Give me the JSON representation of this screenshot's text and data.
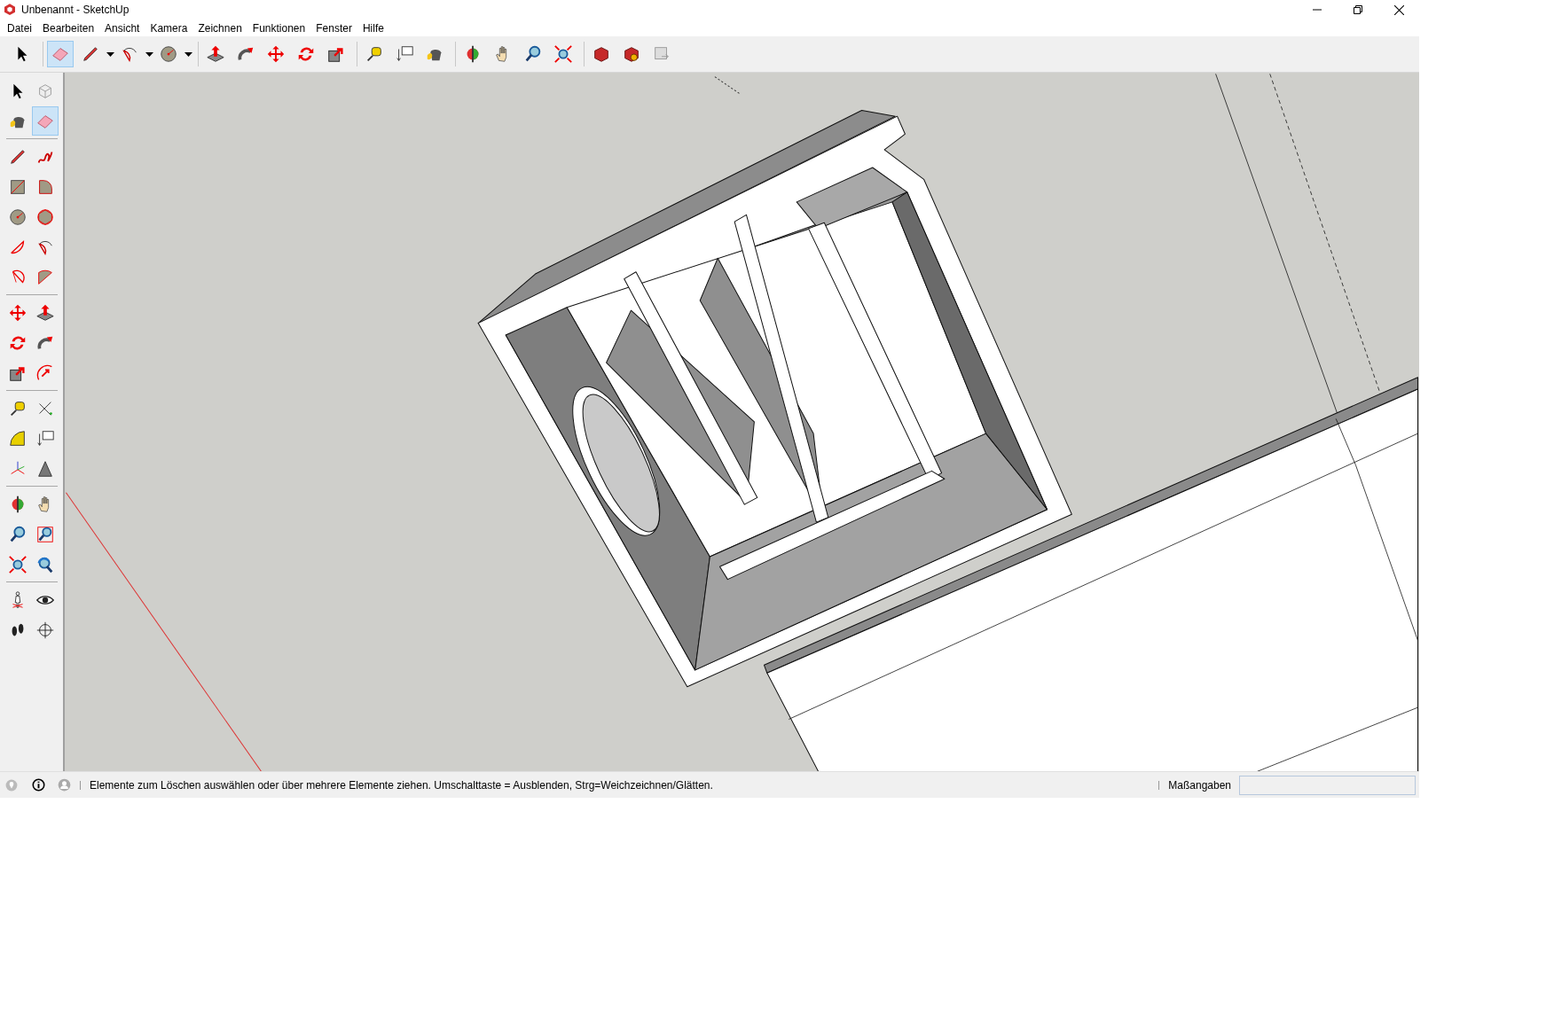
{
  "window": {
    "title": "Unbenannt - SketchUp"
  },
  "menu": [
    "Datei",
    "Bearbeiten",
    "Ansicht",
    "Kamera",
    "Zeichnen",
    "Funktionen",
    "Fenster",
    "Hilfe"
  ],
  "top_toolbar": {
    "groups": [
      [
        {
          "kind": "select",
          "selected": false
        }
      ],
      [
        {
          "kind": "eraser",
          "selected": true
        },
        {
          "kind": "pencil",
          "selected": false,
          "dropdown": true
        },
        {
          "kind": "arc2",
          "selected": false,
          "dropdown": true
        },
        {
          "kind": "circle",
          "selected": false,
          "dropdown": true
        }
      ],
      [
        {
          "kind": "pushpull",
          "selected": false
        },
        {
          "kind": "followme",
          "selected": false
        },
        {
          "kind": "move",
          "selected": false
        },
        {
          "kind": "rotate",
          "selected": false
        },
        {
          "kind": "scale",
          "selected": false
        }
      ],
      [
        {
          "kind": "tape",
          "selected": false
        },
        {
          "kind": "text",
          "selected": false
        },
        {
          "kind": "paint",
          "selected": false
        }
      ],
      [
        {
          "kind": "orbit",
          "selected": false
        },
        {
          "kind": "pan",
          "selected": false
        },
        {
          "kind": "zoom",
          "selected": false
        },
        {
          "kind": "zoomext",
          "selected": false
        }
      ],
      [
        {
          "kind": "warehouse",
          "selected": false
        },
        {
          "kind": "extwarehouse",
          "selected": false
        },
        {
          "kind": "layout",
          "selected": false
        }
      ]
    ]
  },
  "left_toolbar": {
    "groups": [
      [
        {
          "kind": "select",
          "selected": false
        },
        {
          "kind": "component",
          "selected": false
        },
        {
          "kind": "paint",
          "selected": false
        },
        {
          "kind": "eraser",
          "selected": true
        }
      ],
      [
        {
          "kind": "pencil",
          "selected": false
        },
        {
          "kind": "freehand",
          "selected": false
        },
        {
          "kind": "rectangle",
          "selected": false
        },
        {
          "kind": "rotrect",
          "selected": false
        },
        {
          "kind": "circle",
          "selected": false
        },
        {
          "kind": "polygon",
          "selected": false
        },
        {
          "kind": "arc",
          "selected": false
        },
        {
          "kind": "arc2",
          "selected": false
        },
        {
          "kind": "arc3",
          "selected": false
        },
        {
          "kind": "pie",
          "selected": false
        }
      ],
      [
        {
          "kind": "move",
          "selected": false
        },
        {
          "kind": "pushpull",
          "selected": false
        },
        {
          "kind": "rotate",
          "selected": false
        },
        {
          "kind": "followme",
          "selected": false
        },
        {
          "kind": "scale",
          "selected": false
        },
        {
          "kind": "offset",
          "selected": false
        }
      ],
      [
        {
          "kind": "tape",
          "selected": false
        },
        {
          "kind": "dimension",
          "selected": false
        },
        {
          "kind": "protractor",
          "selected": false
        },
        {
          "kind": "text",
          "selected": false
        },
        {
          "kind": "axes",
          "selected": false
        },
        {
          "kind": "text3d",
          "selected": false
        }
      ],
      [
        {
          "kind": "orbit",
          "selected": false
        },
        {
          "kind": "pan",
          "selected": false
        },
        {
          "kind": "zoom",
          "selected": false
        },
        {
          "kind": "zoomwin",
          "selected": false
        },
        {
          "kind": "zoomext",
          "selected": false
        },
        {
          "kind": "previous",
          "selected": false
        }
      ],
      [
        {
          "kind": "camera",
          "selected": false
        },
        {
          "kind": "look",
          "selected": false
        },
        {
          "kind": "walk",
          "selected": false
        },
        {
          "kind": "section",
          "selected": false
        }
      ]
    ]
  },
  "status_bar": {
    "message": "Elemente zum Löschen auswählen oder über mehrere Elemente ziehen. Umschalttaste = Ausblenden, Strg=Weichzeichnen/Glätten.",
    "measurements_label": "Maßangaben"
  }
}
